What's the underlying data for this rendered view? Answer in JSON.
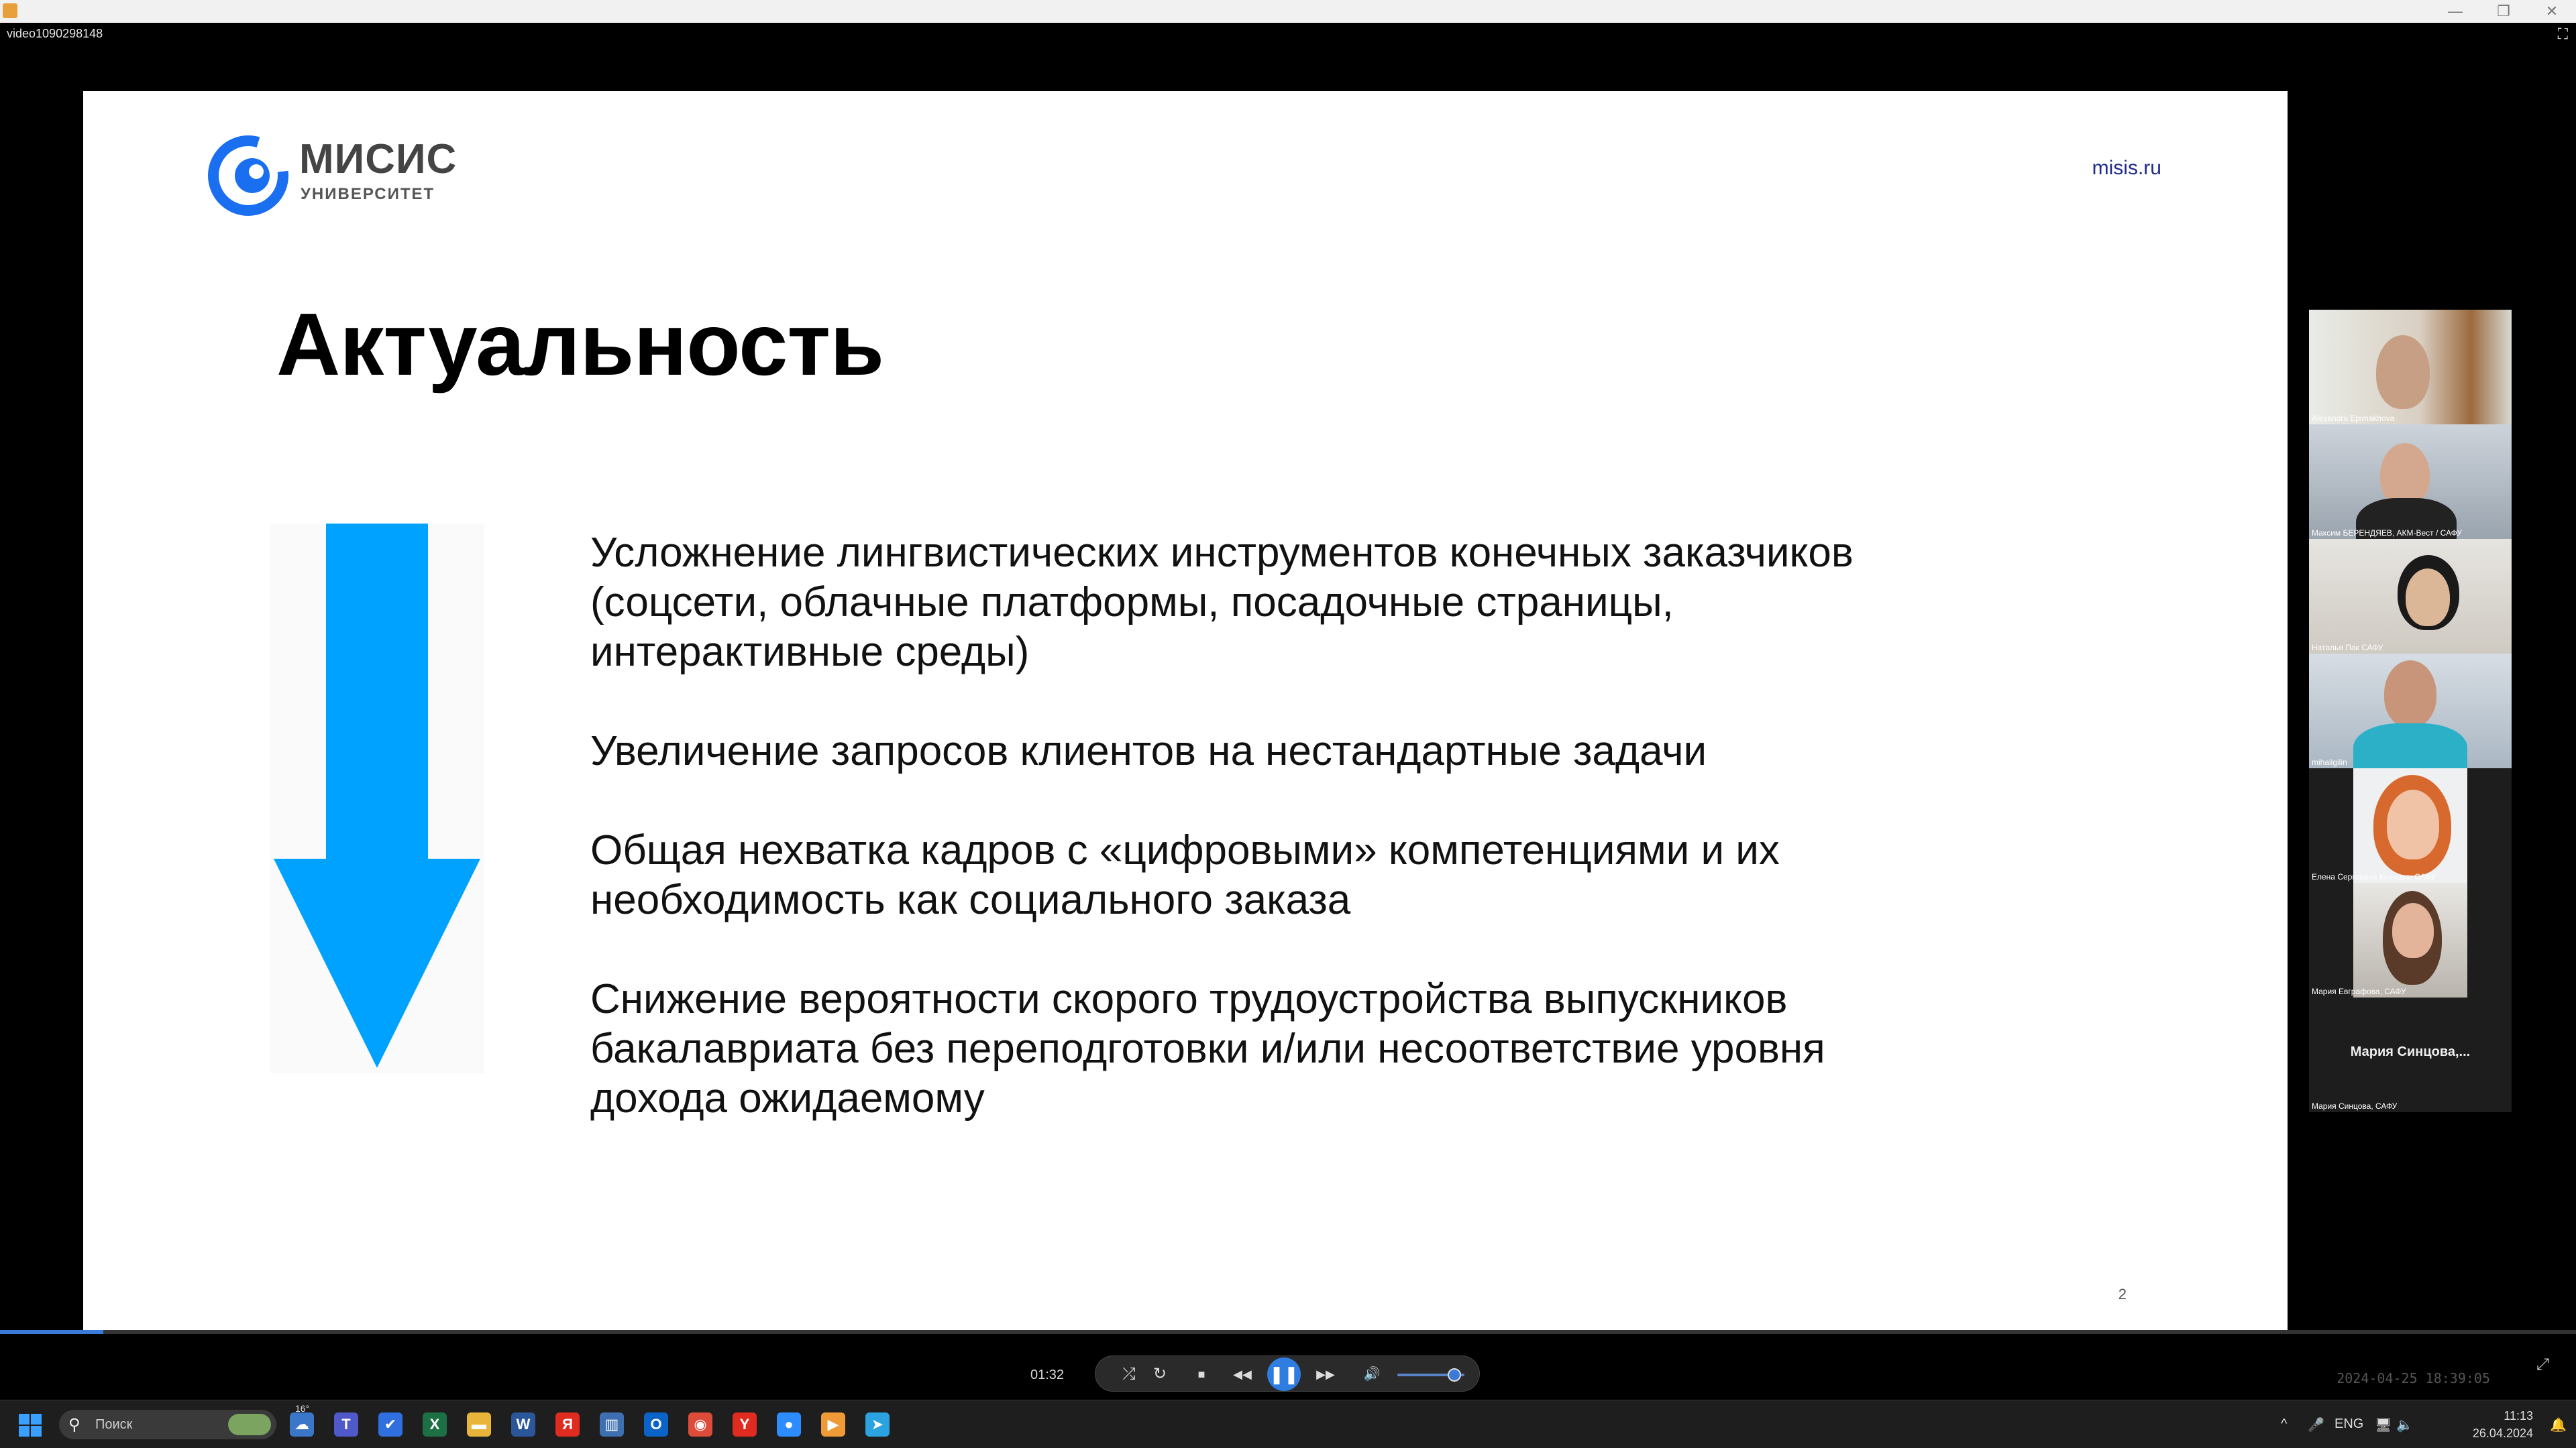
{
  "window": {
    "filename": "video1090298148",
    "min_glyph": "—",
    "max_glyph": "❐",
    "close_glyph": "✕",
    "fullscreen_glyph": "⛶"
  },
  "slide": {
    "logo_main": "МИСИС",
    "logo_sub": "УНИВЕРСИТЕТ",
    "site": "misis.ru",
    "title": "Актуальность",
    "bullets": [
      "Усложнение лингвистических инструментов конечных заказчиков\n(соцсети, облачные платформы, посадочные страницы,\nинтерактивные среды)",
      "Увеличение запросов клиентов на нестандартные задачи",
      "Общая нехватка кадров с «цифровыми» компетенциями и их\nнеобходимость как социального заказа",
      "Снижение вероятности скорого трудоустройства выпускников\nбакалавриата без переподготовки и/или несоответствие уровня\nдохода ожидаемому"
    ],
    "page_number": "2",
    "arrow_color": "#00a2ff",
    "logo_color": "#1a6ff0"
  },
  "participants": [
    {
      "name": "Alexandra Epimakhova"
    },
    {
      "name": "Максим БЕРЕНДЯЕВ, АКМ-Вест / САФУ"
    },
    {
      "name": "Наталья Пак САФУ"
    },
    {
      "name": "mihailgilin"
    },
    {
      "name": "Елена Сергеевна Кохнова, САФУ"
    },
    {
      "name": "Мария Евграфова, САФУ"
    },
    {
      "name": "Мария Синцова, САФУ",
      "display": "Мария  Синцова,..."
    }
  ],
  "player": {
    "elapsed": "01:32",
    "timestamp": "2024-04-25 18:39:05",
    "progress_fraction": 0.04,
    "volume_fraction": 0.85,
    "btn_shuffle": "⤮",
    "btn_repeat": "↻",
    "btn_stop": "■",
    "btn_rewind": "◀◀",
    "btn_pause": "❚❚",
    "btn_forward": "▶▶",
    "btn_volume": "🔊",
    "expand": "⤢"
  },
  "taskbar": {
    "search_placeholder": "Поиск",
    "weather_temp": "16°",
    "tray_lang": "ENG",
    "tray_caret": "^",
    "time": "11:13",
    "date": "26.04.2024",
    "apps": [
      {
        "name": "weather",
        "glyph": "☁",
        "color": "#3b77c8"
      },
      {
        "name": "teams",
        "glyph": "T",
        "color": "#5059c9"
      },
      {
        "name": "todo",
        "glyph": "✔",
        "color": "#2f6fdf"
      },
      {
        "name": "excel",
        "glyph": "X",
        "color": "#1d7044"
      },
      {
        "name": "explorer",
        "glyph": "▬",
        "color": "#e8b53a"
      },
      {
        "name": "word",
        "glyph": "W",
        "color": "#2b579a"
      },
      {
        "name": "yandex-browser",
        "glyph": "Я",
        "color": "#e02b20"
      },
      {
        "name": "app-blue",
        "glyph": "▥",
        "color": "#3e6fb0"
      },
      {
        "name": "outlook",
        "glyph": "O",
        "color": "#0a64c8"
      },
      {
        "name": "chrome",
        "glyph": "◉",
        "color": "#dd4b39"
      },
      {
        "name": "yandex",
        "glyph": "Y",
        "color": "#e02b20"
      },
      {
        "name": "zoom",
        "glyph": "●",
        "color": "#2d8cff"
      },
      {
        "name": "media-player",
        "glyph": "▶",
        "color": "#f09a37"
      },
      {
        "name": "telegram",
        "glyph": "➤",
        "color": "#2aa3e0"
      }
    ]
  }
}
